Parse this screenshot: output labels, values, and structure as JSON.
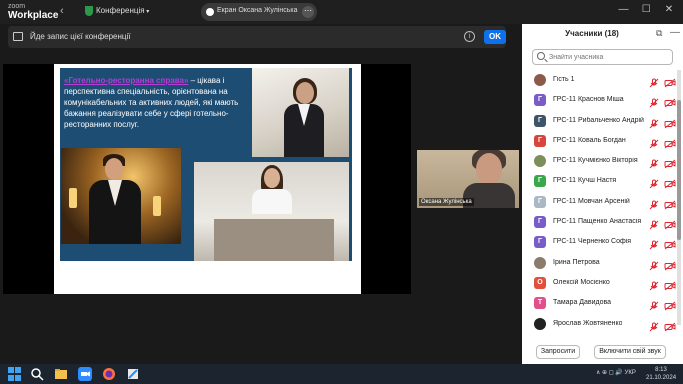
{
  "titlebar": {
    "logo_top": "zoom",
    "logo_bottom": "Workplace",
    "conference_label": "Конференція",
    "screen_share_label": "Екран Оксана Жулінська",
    "more_glyph": "⋯",
    "window_controls": [
      "—",
      "☐",
      "✕"
    ]
  },
  "banner": {
    "text": "Йде запис цієї конференції",
    "info_glyph": "i",
    "ok_label": "OK"
  },
  "slide": {
    "title_highlight": "«Готельно-ресторанна справа»",
    "body_text": " – цікава і перспективна спеціальність, орієнтована на комунікабельних та активних людей, які мають бажання реалізувати себе у сфері готельно-ресторанних послуг."
  },
  "self_video": {
    "name": "Оксана Жулінська"
  },
  "panel": {
    "title": "Учасники (18)",
    "popout_glyph": "⧉",
    "minimize_glyph": "—",
    "search_placeholder": "Знайти учасника",
    "invite_label": "Запросити",
    "unmute_all_label": "Включити свій звук",
    "participants": [
      {
        "name": "Гість 1",
        "avatar_letter": "",
        "avatar_color": "#8b5a4a",
        "mic": "muted",
        "cam": "off"
      },
      {
        "name": "ГРС-11 Краснов Міша",
        "avatar_letter": "Г",
        "avatar_color": "#7a5cc9",
        "mic": "muted",
        "cam": "off"
      },
      {
        "name": "ГРС-11 Рибальченко Андрій",
        "avatar_letter": "Г",
        "avatar_color": "#3f5468",
        "mic": "muted",
        "cam": "off"
      },
      {
        "name": "ГРС-11 Коваль Богдан",
        "avatar_letter": "Г",
        "avatar_color": "#d8453c",
        "mic": "muted",
        "cam": "off"
      },
      {
        "name": "ГРС-11 Кучмієнко Вікторія",
        "avatar_letter": "",
        "avatar_color": "#7c8f5a",
        "mic": "muted",
        "cam": "off"
      },
      {
        "name": "ГРС-11 Кучш Настя",
        "avatar_letter": "Г",
        "avatar_color": "#3aa84a",
        "mic": "muted",
        "cam": "off"
      },
      {
        "name": "ГРС-11 Мовчан Арсеній",
        "avatar_letter": "Г",
        "avatar_color": "#a9b8c4",
        "mic": "muted",
        "cam": "off"
      },
      {
        "name": "ГРС-11 Пащенко Анастасія",
        "avatar_letter": "Г",
        "avatar_color": "#7a5cc9",
        "mic": "muted",
        "cam": "off"
      },
      {
        "name": "ГРС-11 Черненко Софія",
        "avatar_letter": "Г",
        "avatar_color": "#7a5cc9",
        "mic": "muted",
        "cam": "off"
      },
      {
        "name": "Ірина Петрова",
        "avatar_letter": "",
        "avatar_color": "#8c7a6a",
        "mic": "muted",
        "cam": "off"
      },
      {
        "name": "Олексій Мосієнко",
        "avatar_letter": "О",
        "avatar_color": "#e0503a",
        "mic": "muted",
        "cam": "off"
      },
      {
        "name": "Тамара Давидова",
        "avatar_letter": "Т",
        "avatar_color": "#e0508a",
        "mic": "muted",
        "cam": "off"
      },
      {
        "name": "Ярослав Жовтяненко",
        "avatar_letter": "",
        "avatar_color": "#222222",
        "mic": "muted",
        "cam": "off"
      }
    ]
  },
  "taskbar": {
    "tray_text": "∧ ⊕ ◻ 🔊 УКР",
    "clock_time": "8:13",
    "clock_date": "21.10.2024"
  },
  "colors": {
    "accent": "#0e71eb",
    "muted_red": "#e0242f",
    "slide_bg": "#1e4d73",
    "highlight": "#b63cd8"
  }
}
